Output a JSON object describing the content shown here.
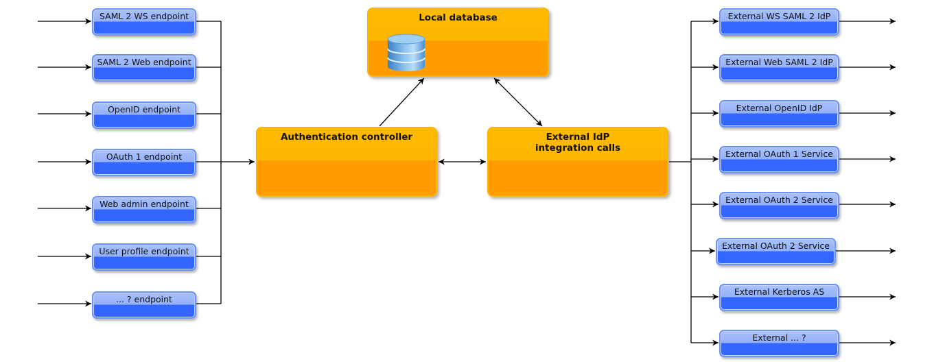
{
  "diagram": {
    "colors": {
      "endpoint_fill_top": "#a9c1fb",
      "endpoint_fill_bottom": "#3366ff",
      "component_fill_top": "#ffb800",
      "component_fill_bottom": "#ff9c00",
      "line": "#000000"
    },
    "endpoints": [
      {
        "label": "SAML 2 WS endpoint"
      },
      {
        "label": "SAML 2 Web endpoint"
      },
      {
        "label": "OpenID endpoint"
      },
      {
        "label": "OAuth 1 endpoint"
      },
      {
        "label": "Web admin endpoint"
      },
      {
        "label": "User profile endpoint"
      },
      {
        "label": "... ? endpoint"
      }
    ],
    "components": {
      "local_database": {
        "label": "Local database",
        "icon": "database-icon"
      },
      "auth_controller": {
        "label": "Authentication controller"
      },
      "external_idp_calls": {
        "label": "External IdP integration calls"
      }
    },
    "external_services": [
      {
        "label": "External WS SAML 2 IdP"
      },
      {
        "label": "External Web SAML 2 IdP"
      },
      {
        "label": "External OpenID IdP"
      },
      {
        "label": "External OAuth 1 Service"
      },
      {
        "label": "External OAuth 2 Service"
      },
      {
        "label": "External OAuth 2 Service"
      },
      {
        "label": "External Kerberos AS"
      },
      {
        "label": "External ... ?"
      }
    ],
    "connections": [
      {
        "from": "endpoints",
        "to": "auth_controller",
        "type": "merge-arrow"
      },
      {
        "from": "auth_controller",
        "to": "local_database",
        "type": "arrow"
      },
      {
        "from": "auth_controller",
        "to": "external_idp_calls",
        "type": "bidirectional"
      },
      {
        "from": "external_idp_calls",
        "to": "local_database",
        "type": "bidirectional"
      },
      {
        "from": "external_idp_calls",
        "to": "external_services",
        "type": "fan-out-arrow"
      }
    ]
  }
}
